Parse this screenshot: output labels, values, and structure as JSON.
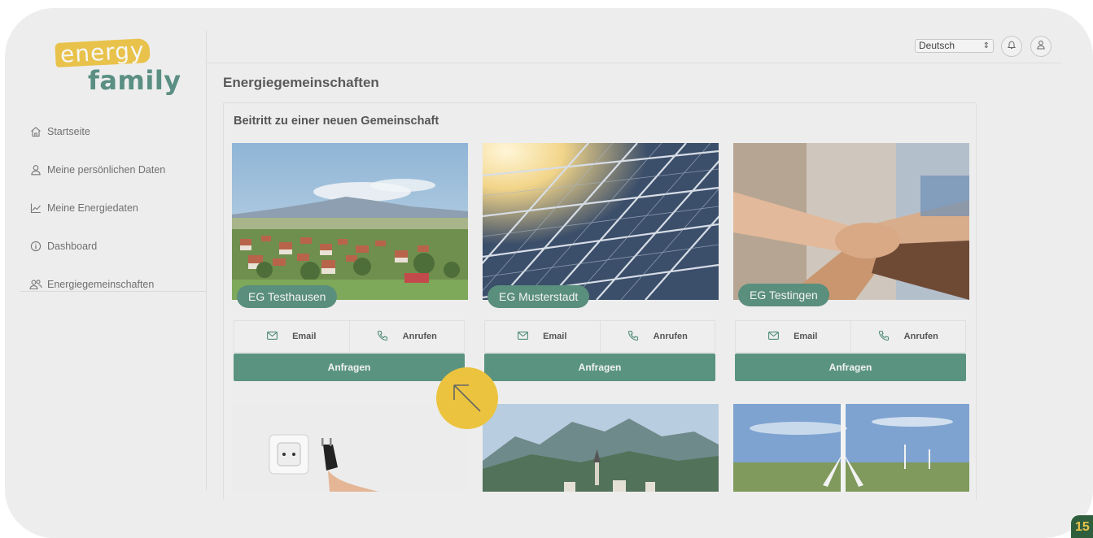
{
  "logo": {
    "line1": "energy",
    "line2": "family"
  },
  "sidebar": {
    "items": [
      {
        "label": "Startseite",
        "icon": "home-icon"
      },
      {
        "label": "Meine persönlichen Daten",
        "icon": "user-icon"
      },
      {
        "label": "Meine Energiedaten",
        "icon": "chart-line-icon"
      },
      {
        "label": "Dashboard",
        "icon": "info-circle-icon"
      },
      {
        "label": "Energiegemeinschaften",
        "icon": "users-icon"
      }
    ]
  },
  "header": {
    "language": "Deutsch",
    "notification_icon": "bell-icon",
    "profile_icon": "user-icon"
  },
  "main": {
    "title": "Energiegemeinschaften",
    "section_title": "Beitritt zu einer neuen Gemeinschaft",
    "cards": [
      {
        "name": "EG Testhausen",
        "email_label": "Email",
        "call_label": "Anrufen",
        "request_label": "Anfragen"
      },
      {
        "name": "EG Musterstadt",
        "email_label": "Email",
        "call_label": "Anrufen",
        "request_label": "Anfragen"
      },
      {
        "name": "EG Testingen",
        "email_label": "Email",
        "call_label": "Anrufen",
        "request_label": "Anfragen"
      }
    ]
  },
  "badge": "15",
  "colors": {
    "accent": "#5a9481",
    "brand_yellow": "#e8c24a",
    "cursor": "#ecc33f"
  }
}
